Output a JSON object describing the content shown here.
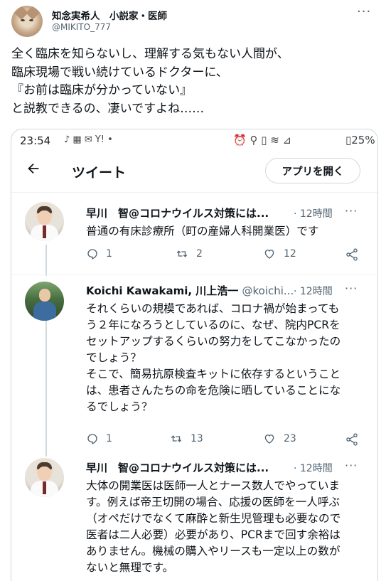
{
  "outer_tweet": {
    "author_name": "知念実希人　小説家・医師",
    "author_handle": "@MIKITO_777",
    "more_icon": "more-horizontal-icon",
    "text_lines": [
      "全く臨床を知らないし、理解する気もない人間が、",
      "臨床現場で戦い続けているドクターに、",
      "『お前は臨床が分かっていない』",
      "と説教できるの、凄いですよね……"
    ]
  },
  "phone": {
    "status_bar": {
      "time": "23:54",
      "left_icons": "♪ ▦ ✉ Y! •",
      "right_icons": "⏰ ⚲ ▯ ≋ ⊿",
      "battery": "▯25%"
    },
    "app_bar": {
      "back_icon": "arrow-left-icon",
      "title": "ツイート",
      "open_app_button": "アプリを開く"
    },
    "replies": [
      {
        "name": "早川　智@コロナウイルス対策には...",
        "handle": "",
        "time": "· 12時間",
        "lines": [
          "普通の有床診療所（町の産婦人科開業医）です"
        ],
        "replies": "1",
        "retweets": "2",
        "likes": "12"
      },
      {
        "name": "Koichi Kawakami, 川上浩一",
        "handle": "@koichi...",
        "time": "· 12時間",
        "lines": [
          "それくらいの規模であれば、コロナ禍が始まっても",
          "う２年になろうとしているのに、なぜ、院内PCRを",
          "セットアップするくらいの努力をしてこなかったの",
          "でしょう？",
          "そこで、簡易抗原検査キットに依存するということ",
          "は、患者さんたちの命を危険に晒していることにな",
          "るでしょう？"
        ],
        "replies": "1",
        "retweets": "13",
        "likes": "23"
      },
      {
        "name": "早川　智@コロナウイルス対策には...",
        "handle": "",
        "time": "· 12時間",
        "lines": [
          "大体の開業医は医師一人とナース数人でやっていま",
          "す。例えば帝王切開の場合、応援の医師を一人呼ぶ",
          "（オペだけでなくて麻酔と新生児管理も必要なので",
          "医者は二人必要）必要があり、PCRまで回す余裕は",
          "ありません。機械の購入やリースも一定以上の数が",
          "ないと無理です。"
        ]
      }
    ]
  }
}
